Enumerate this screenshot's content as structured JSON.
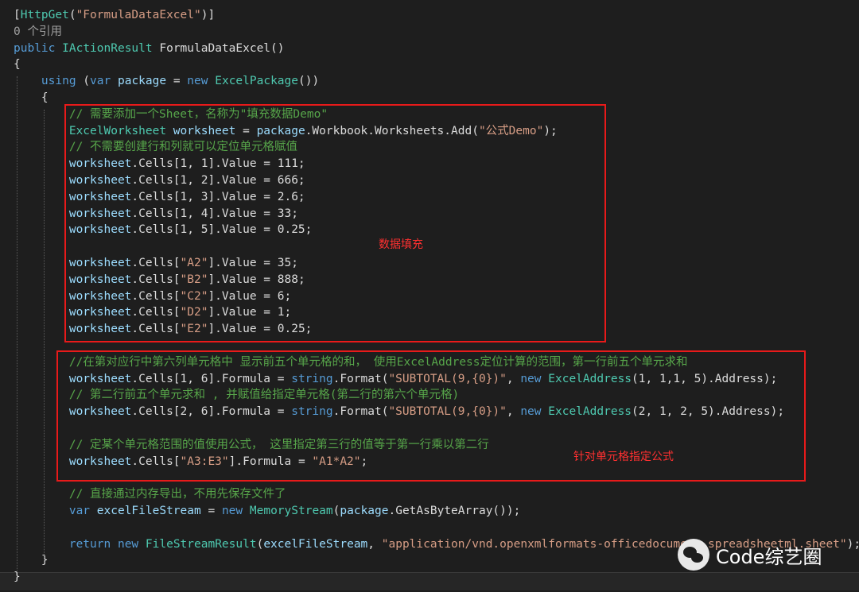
{
  "editor": {
    "lines": [
      {
        "tokens": [
          {
            "t": "[",
            "c": "pl"
          },
          {
            "t": "HttpGet",
            "c": "ty"
          },
          {
            "t": "(",
            "c": "pl"
          },
          {
            "t": "\"FormulaDataExcel\"",
            "c": "st"
          },
          {
            "t": ")]",
            "c": "pl"
          }
        ]
      },
      {
        "tokens": [
          {
            "t": "0 个引用",
            "c": "gray"
          }
        ]
      },
      {
        "tokens": [
          {
            "t": "public",
            "c": "kw"
          },
          {
            "t": " ",
            "c": "pl"
          },
          {
            "t": "IActionResult",
            "c": "ty"
          },
          {
            "t": " FormulaDataExcel()",
            "c": "pl"
          }
        ]
      },
      {
        "tokens": [
          {
            "t": "{",
            "c": "pl"
          }
        ]
      },
      {
        "tokens": [
          {
            "t": "    ",
            "c": "pl"
          },
          {
            "t": "using",
            "c": "kw"
          },
          {
            "t": " (",
            "c": "pl"
          },
          {
            "t": "var",
            "c": "kw"
          },
          {
            "t": " ",
            "c": "pl"
          },
          {
            "t": "package",
            "c": "id"
          },
          {
            "t": " = ",
            "c": "pl"
          },
          {
            "t": "new",
            "c": "kw"
          },
          {
            "t": " ",
            "c": "pl"
          },
          {
            "t": "ExcelPackage",
            "c": "ty"
          },
          {
            "t": "())",
            "c": "pl"
          }
        ]
      },
      {
        "tokens": [
          {
            "t": "    {",
            "c": "pl"
          }
        ]
      },
      {
        "tokens": [
          {
            "t": "        ",
            "c": "pl"
          },
          {
            "t": "// 需要添加一个Sheet，名称为\"填充数据Demo\"",
            "c": "cm"
          }
        ]
      },
      {
        "tokens": [
          {
            "t": "        ",
            "c": "pl"
          },
          {
            "t": "ExcelWorksheet",
            "c": "ty"
          },
          {
            "t": " ",
            "c": "pl"
          },
          {
            "t": "worksheet",
            "c": "id"
          },
          {
            "t": " = ",
            "c": "pl"
          },
          {
            "t": "package",
            "c": "id"
          },
          {
            "t": ".Workbook.Worksheets.Add(",
            "c": "pl"
          },
          {
            "t": "\"公式Demo\"",
            "c": "st"
          },
          {
            "t": ");",
            "c": "pl"
          }
        ]
      },
      {
        "tokens": [
          {
            "t": "        ",
            "c": "pl"
          },
          {
            "t": "// 不需要创建行和列就可以定位单元格赋值",
            "c": "cm"
          }
        ]
      },
      {
        "tokens": [
          {
            "t": "        ",
            "c": "pl"
          },
          {
            "t": "worksheet",
            "c": "id"
          },
          {
            "t": ".Cells[1, 1].Value = 111;",
            "c": "pl"
          }
        ]
      },
      {
        "tokens": [
          {
            "t": "        ",
            "c": "pl"
          },
          {
            "t": "worksheet",
            "c": "id"
          },
          {
            "t": ".Cells[1, 2].Value = 666;",
            "c": "pl"
          }
        ]
      },
      {
        "tokens": [
          {
            "t": "        ",
            "c": "pl"
          },
          {
            "t": "worksheet",
            "c": "id"
          },
          {
            "t": ".Cells[1, 3].Value = 2.6;",
            "c": "pl"
          }
        ]
      },
      {
        "tokens": [
          {
            "t": "        ",
            "c": "pl"
          },
          {
            "t": "worksheet",
            "c": "id"
          },
          {
            "t": ".Cells[1, 4].Value = 33;",
            "c": "pl"
          }
        ]
      },
      {
        "tokens": [
          {
            "t": "        ",
            "c": "pl"
          },
          {
            "t": "worksheet",
            "c": "id"
          },
          {
            "t": ".Cells[1, 5].Value = 0.25;",
            "c": "pl"
          }
        ]
      },
      {
        "tokens": []
      },
      {
        "tokens": [
          {
            "t": "        ",
            "c": "pl"
          },
          {
            "t": "worksheet",
            "c": "id"
          },
          {
            "t": ".Cells[",
            "c": "pl"
          },
          {
            "t": "\"A2\"",
            "c": "st"
          },
          {
            "t": "].Value = 35;",
            "c": "pl"
          }
        ]
      },
      {
        "tokens": [
          {
            "t": "        ",
            "c": "pl"
          },
          {
            "t": "worksheet",
            "c": "id"
          },
          {
            "t": ".Cells[",
            "c": "pl"
          },
          {
            "t": "\"B2\"",
            "c": "st"
          },
          {
            "t": "].Value = 888;",
            "c": "pl"
          }
        ]
      },
      {
        "tokens": [
          {
            "t": "        ",
            "c": "pl"
          },
          {
            "t": "worksheet",
            "c": "id"
          },
          {
            "t": ".Cells[",
            "c": "pl"
          },
          {
            "t": "\"C2\"",
            "c": "st"
          },
          {
            "t": "].Value = 6;",
            "c": "pl"
          }
        ]
      },
      {
        "tokens": [
          {
            "t": "        ",
            "c": "pl"
          },
          {
            "t": "worksheet",
            "c": "id"
          },
          {
            "t": ".Cells[",
            "c": "pl"
          },
          {
            "t": "\"D2\"",
            "c": "st"
          },
          {
            "t": "].Value = 1;",
            "c": "pl"
          }
        ]
      },
      {
        "tokens": [
          {
            "t": "        ",
            "c": "pl"
          },
          {
            "t": "worksheet",
            "c": "id"
          },
          {
            "t": ".Cells[",
            "c": "pl"
          },
          {
            "t": "\"E2\"",
            "c": "st"
          },
          {
            "t": "].Value = 0.25;",
            "c": "pl"
          }
        ]
      },
      {
        "tokens": []
      },
      {
        "tokens": [
          {
            "t": "        ",
            "c": "pl"
          },
          {
            "t": "//在第对应行中第六列单元格中 显示前五个单元格的和， 使用ExcelAddress定位计算的范围，第一行前五个单元求和",
            "c": "cm"
          }
        ]
      },
      {
        "tokens": [
          {
            "t": "        ",
            "c": "pl"
          },
          {
            "t": "worksheet",
            "c": "id"
          },
          {
            "t": ".Cells[1, 6].Formula = ",
            "c": "pl"
          },
          {
            "t": "string",
            "c": "kw"
          },
          {
            "t": ".Format(",
            "c": "pl"
          },
          {
            "t": "\"SUBTOTAL(9,{0})\"",
            "c": "st"
          },
          {
            "t": ", ",
            "c": "pl"
          },
          {
            "t": "new",
            "c": "kw"
          },
          {
            "t": " ",
            "c": "pl"
          },
          {
            "t": "ExcelAddress",
            "c": "ty"
          },
          {
            "t": "(1, 1,1, 5).Address);",
            "c": "pl"
          }
        ]
      },
      {
        "tokens": [
          {
            "t": "        ",
            "c": "pl"
          },
          {
            "t": "// 第二行前五个单元求和 , 并赋值给指定单元格(第二行的第六个单元格)",
            "c": "cm"
          }
        ]
      },
      {
        "tokens": [
          {
            "t": "        ",
            "c": "pl"
          },
          {
            "t": "worksheet",
            "c": "id"
          },
          {
            "t": ".Cells[2, 6].Formula = ",
            "c": "pl"
          },
          {
            "t": "string",
            "c": "kw"
          },
          {
            "t": ".Format(",
            "c": "pl"
          },
          {
            "t": "\"SUBTOTAL(9,{0})\"",
            "c": "st"
          },
          {
            "t": ", ",
            "c": "pl"
          },
          {
            "t": "new",
            "c": "kw"
          },
          {
            "t": " ",
            "c": "pl"
          },
          {
            "t": "ExcelAddress",
            "c": "ty"
          },
          {
            "t": "(2, 1, 2, 5).Address);",
            "c": "pl"
          }
        ]
      },
      {
        "tokens": []
      },
      {
        "tokens": [
          {
            "t": "        ",
            "c": "pl"
          },
          {
            "t": "// 定某个单元格范围的值使用公式， 这里指定第三行的值等于第一行乘以第二行",
            "c": "cm"
          }
        ]
      },
      {
        "tokens": [
          {
            "t": "        ",
            "c": "pl"
          },
          {
            "t": "worksheet",
            "c": "id"
          },
          {
            "t": ".Cells[",
            "c": "pl"
          },
          {
            "t": "\"A3:E3\"",
            "c": "st"
          },
          {
            "t": "].Formula = ",
            "c": "pl"
          },
          {
            "t": "\"A1*A2\"",
            "c": "st"
          },
          {
            "t": ";",
            "c": "pl"
          }
        ]
      },
      {
        "tokens": []
      },
      {
        "tokens": [
          {
            "t": "        ",
            "c": "pl"
          },
          {
            "t": "// 直接通过内存导出，不用先保存文件了",
            "c": "cm"
          }
        ]
      },
      {
        "tokens": [
          {
            "t": "        ",
            "c": "pl"
          },
          {
            "t": "var",
            "c": "kw"
          },
          {
            "t": " ",
            "c": "pl"
          },
          {
            "t": "excelFileStream",
            "c": "id"
          },
          {
            "t": " = ",
            "c": "pl"
          },
          {
            "t": "new",
            "c": "kw"
          },
          {
            "t": " ",
            "c": "pl"
          },
          {
            "t": "MemoryStream",
            "c": "ty"
          },
          {
            "t": "(",
            "c": "pl"
          },
          {
            "t": "package",
            "c": "id"
          },
          {
            "t": ".GetAsByteArray());",
            "c": "pl"
          }
        ]
      },
      {
        "tokens": []
      },
      {
        "tokens": [
          {
            "t": "        ",
            "c": "pl"
          },
          {
            "t": "return",
            "c": "kw"
          },
          {
            "t": " ",
            "c": "pl"
          },
          {
            "t": "new",
            "c": "kw"
          },
          {
            "t": " ",
            "c": "pl"
          },
          {
            "t": "FileStreamResult",
            "c": "ty"
          },
          {
            "t": "(",
            "c": "pl"
          },
          {
            "t": "excelFileStream",
            "c": "id"
          },
          {
            "t": ", ",
            "c": "pl"
          },
          {
            "t": "\"application/vnd.openxmlformats-officedocument.spreadsheetml.sheet\"",
            "c": "st"
          },
          {
            "t": ");",
            "c": "pl"
          }
        ]
      },
      {
        "tokens": [
          {
            "t": "    }",
            "c": "pl"
          }
        ]
      },
      {
        "tokens": [
          {
            "t": "}",
            "c": "pl"
          }
        ]
      }
    ]
  },
  "annotations": {
    "data_fill_label": "数据填充",
    "formula_label": "针对单元格指定公式",
    "box_color": "#e81a1a"
  },
  "watermark": {
    "icon": "wechat-icon",
    "text": "Code综艺圈"
  }
}
